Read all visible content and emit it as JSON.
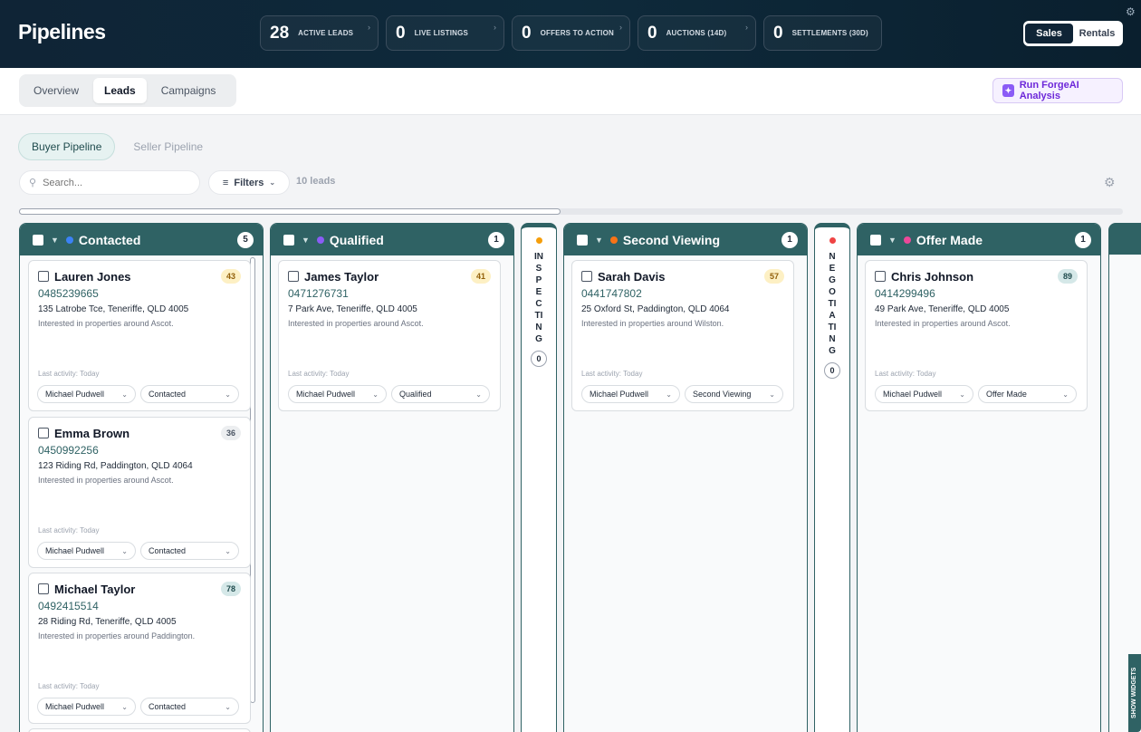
{
  "header": {
    "title": "Pipelines",
    "stats": [
      {
        "value": "28",
        "label": "ACTIVE LEADS"
      },
      {
        "value": "0",
        "label": "LIVE LISTINGS"
      },
      {
        "value": "0",
        "label": "OFFERS TO ACTION"
      },
      {
        "value": "0",
        "label": "AUCTIONS (14D)"
      },
      {
        "value": "0",
        "label": "SETTLEMENTS (30D)"
      }
    ],
    "mode": {
      "sales": "Sales",
      "rentals": "Rentals",
      "selected": "Sales"
    }
  },
  "nav": {
    "tabs": [
      "Overview",
      "Leads",
      "Campaigns"
    ],
    "active_tab": "Leads",
    "ai_button": "Run ForgeAI Analysis"
  },
  "pipeline": {
    "tabs": [
      "Buyer Pipeline",
      "Seller Pipeline"
    ],
    "active": "Buyer Pipeline"
  },
  "toolbar": {
    "search_placeholder": "Search...",
    "filters_label": "Filters",
    "lead_count": "10 leads"
  },
  "colors": {
    "contacted": "#3b82f6",
    "qualified": "#8b5cf6",
    "inspecting": "#f59e0b",
    "second_viewing": "#f97316",
    "negotiating": "#ef4444",
    "offer_made": "#ec4899",
    "column_header": "#2f6264"
  },
  "columns": [
    {
      "title": "Contacted",
      "count": "5",
      "cards": [
        {
          "name": "Lauren Jones",
          "score": "43",
          "phone": "0485239665",
          "address": "135 Latrobe Tce, Teneriffe, QLD 4005",
          "note": "Interested in properties around Ascot.",
          "last_activity": "Last activity: Today",
          "agent": "Michael Pudwell",
          "status": "Contacted"
        },
        {
          "name": "Emma Brown",
          "score": "36",
          "phone": "0450992256",
          "address": "123 Riding Rd, Paddington, QLD 4064",
          "note": "Interested in properties around Ascot.",
          "last_activity": "Last activity: Today",
          "agent": "Michael Pudwell",
          "status": "Contacted"
        },
        {
          "name": "Michael Taylor",
          "score": "78",
          "phone": "0492415514",
          "address": "28 Riding Rd, Teneriffe, QLD 4005",
          "note": "Interested in properties around Paddington.",
          "last_activity": "Last activity: Today",
          "agent": "Michael Pudwell",
          "status": "Contacted"
        }
      ]
    },
    {
      "title": "Qualified",
      "count": "1",
      "cards": [
        {
          "name": "James Taylor",
          "score": "41",
          "phone": "0471276731",
          "address": "7 Park Ave, Teneriffe, QLD 4005",
          "note": "Interested in properties around Ascot.",
          "last_activity": "Last activity: Today",
          "agent": "Michael Pudwell",
          "status": "Qualified"
        }
      ]
    },
    {
      "title": "Second Viewing",
      "count": "1",
      "cards": [
        {
          "name": "Sarah Davis",
          "score": "57",
          "phone": "0441747802",
          "address": "25 Oxford St, Paddington, QLD 4064",
          "note": "Interested in properties around Wilston.",
          "last_activity": "Last activity: Today",
          "agent": "Michael Pudwell",
          "status": "Second Viewing"
        }
      ]
    },
    {
      "title": "Offer Made",
      "count": "1",
      "cards": [
        {
          "name": "Chris Johnson",
          "score": "89",
          "phone": "0414299496",
          "address": "49 Park Ave, Teneriffe, QLD 4005",
          "note": "Interested in properties around Ascot.",
          "last_activity": "Last activity: Today",
          "agent": "Michael Pudwell",
          "status": "Offer Made"
        }
      ]
    }
  ],
  "collapsed": [
    {
      "title": "INSPECTING",
      "count": "0"
    },
    {
      "title": "NEGOTIATING",
      "count": "0"
    }
  ],
  "widgets_label": "SHOW WIDGETS"
}
